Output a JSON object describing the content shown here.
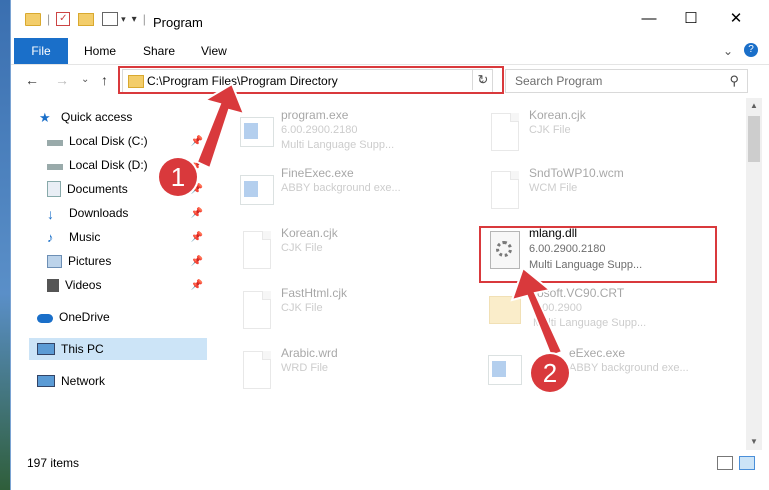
{
  "window": {
    "title": "Program",
    "controls": {
      "minimize": "—",
      "maximize": "☐",
      "close": "✕"
    }
  },
  "ribbon": {
    "file": "File",
    "tabs": [
      "Home",
      "Share",
      "View"
    ],
    "expand": "⌄",
    "help": "?"
  },
  "nav": {
    "back": "←",
    "forward": "→",
    "recent": "⌄",
    "up": "↑",
    "address": "C:\\Program Files\\Program Directory",
    "address_dropdown": "⌄",
    "refresh": "↻",
    "search_placeholder": "Search Program",
    "search_icon": "⚲"
  },
  "sidebar": {
    "items": [
      {
        "label": "Quick access",
        "icon": "star-icon",
        "pinned": false
      },
      {
        "label": "Local Disk (C:)",
        "icon": "drive-icon",
        "pinned": true
      },
      {
        "label": "Local Disk (D:)",
        "icon": "drive-icon",
        "pinned": true
      },
      {
        "label": "Documents",
        "icon": "documents-icon",
        "pinned": true
      },
      {
        "label": "Downloads",
        "icon": "downloads-icon",
        "pinned": true
      },
      {
        "label": "Music",
        "icon": "music-icon",
        "pinned": true
      },
      {
        "label": "Pictures",
        "icon": "pictures-icon",
        "pinned": true
      },
      {
        "label": "Videos",
        "icon": "videos-icon",
        "pinned": true
      },
      {
        "label": "OneDrive",
        "icon": "cloud-icon",
        "pinned": false
      },
      {
        "label": "This PC",
        "icon": "computer-icon",
        "pinned": false,
        "selected": true
      },
      {
        "label": "Network",
        "icon": "network-icon",
        "pinned": false
      }
    ]
  },
  "files": [
    {
      "name": "program.exe",
      "line2": "6.00.2900.2180",
      "line3": "Multi Language Supp...",
      "type": "exe"
    },
    {
      "name": "Korean.cjk",
      "line2": "CJK File",
      "line3": "",
      "type": "doc"
    },
    {
      "name": "FineExec.exe",
      "line2": "ABBY background exe...",
      "line3": "",
      "type": "exe"
    },
    {
      "name": "SndToWP10.wcm",
      "line2": "WCM File",
      "line3": "",
      "type": "doc"
    },
    {
      "name": "Korean.cjk",
      "line2": "CJK File",
      "line3": "",
      "type": "doc"
    },
    {
      "name": "mlang.dll",
      "line2": "6.00.2900.2180",
      "line3": "Multi Language Supp...",
      "type": "dll",
      "highlighted": true
    },
    {
      "name": "FastHtml.cjk",
      "line2": "CJK File",
      "line3": "",
      "type": "doc"
    },
    {
      "name": "rosoft.VC90.CRT",
      "line2": "6.00.2900",
      "line3": "Multi Language Supp...",
      "type": "folder"
    },
    {
      "name": "Arabic.wrd",
      "line2": "WRD File",
      "line3": "",
      "type": "doc"
    },
    {
      "name": "eExec.exe",
      "line2": "ABBY background exe...",
      "line3": "",
      "type": "exe"
    }
  ],
  "status": {
    "count": "197 items"
  },
  "annotations": {
    "badge1": "1",
    "badge2": "2",
    "color": "#d9393c"
  }
}
